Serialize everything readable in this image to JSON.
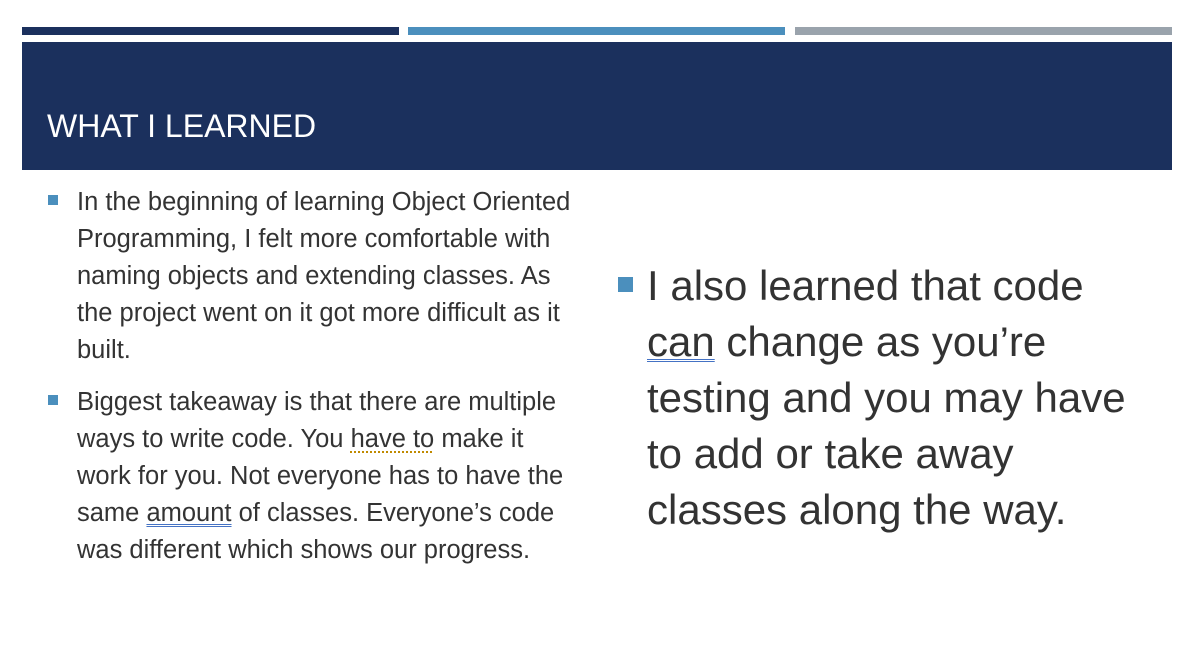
{
  "slide": {
    "title": "WHAT I LEARNED",
    "colors": {
      "band": "#1b305d",
      "accent_dark": "#1b305d",
      "accent_blue": "#4b8fbd",
      "accent_gray": "#9aa3ac",
      "bullet": "#4b8fbd",
      "text": "#333333"
    }
  },
  "left_column": {
    "bullet1": "In the beginning of learning Object Oriented Programming, I felt more comfortable with naming objects and extending classes.  As the project went on it got more difficult as it built.",
    "bullet2": {
      "part1": " Biggest takeaway is that there are multiple ways to write code. You ",
      "marked1": "have to",
      "part2": " make it work for you. Not everyone has to have the same ",
      "marked2": "amount",
      "part3": " of classes. Everyone’s code was different which shows our progress."
    }
  },
  "right_column": {
    "bullet1": {
      "part1": " I also learned that code ",
      "marked1": "can",
      "part2": " change as you’re testing and you may have to add or take away classes along the way."
    }
  }
}
